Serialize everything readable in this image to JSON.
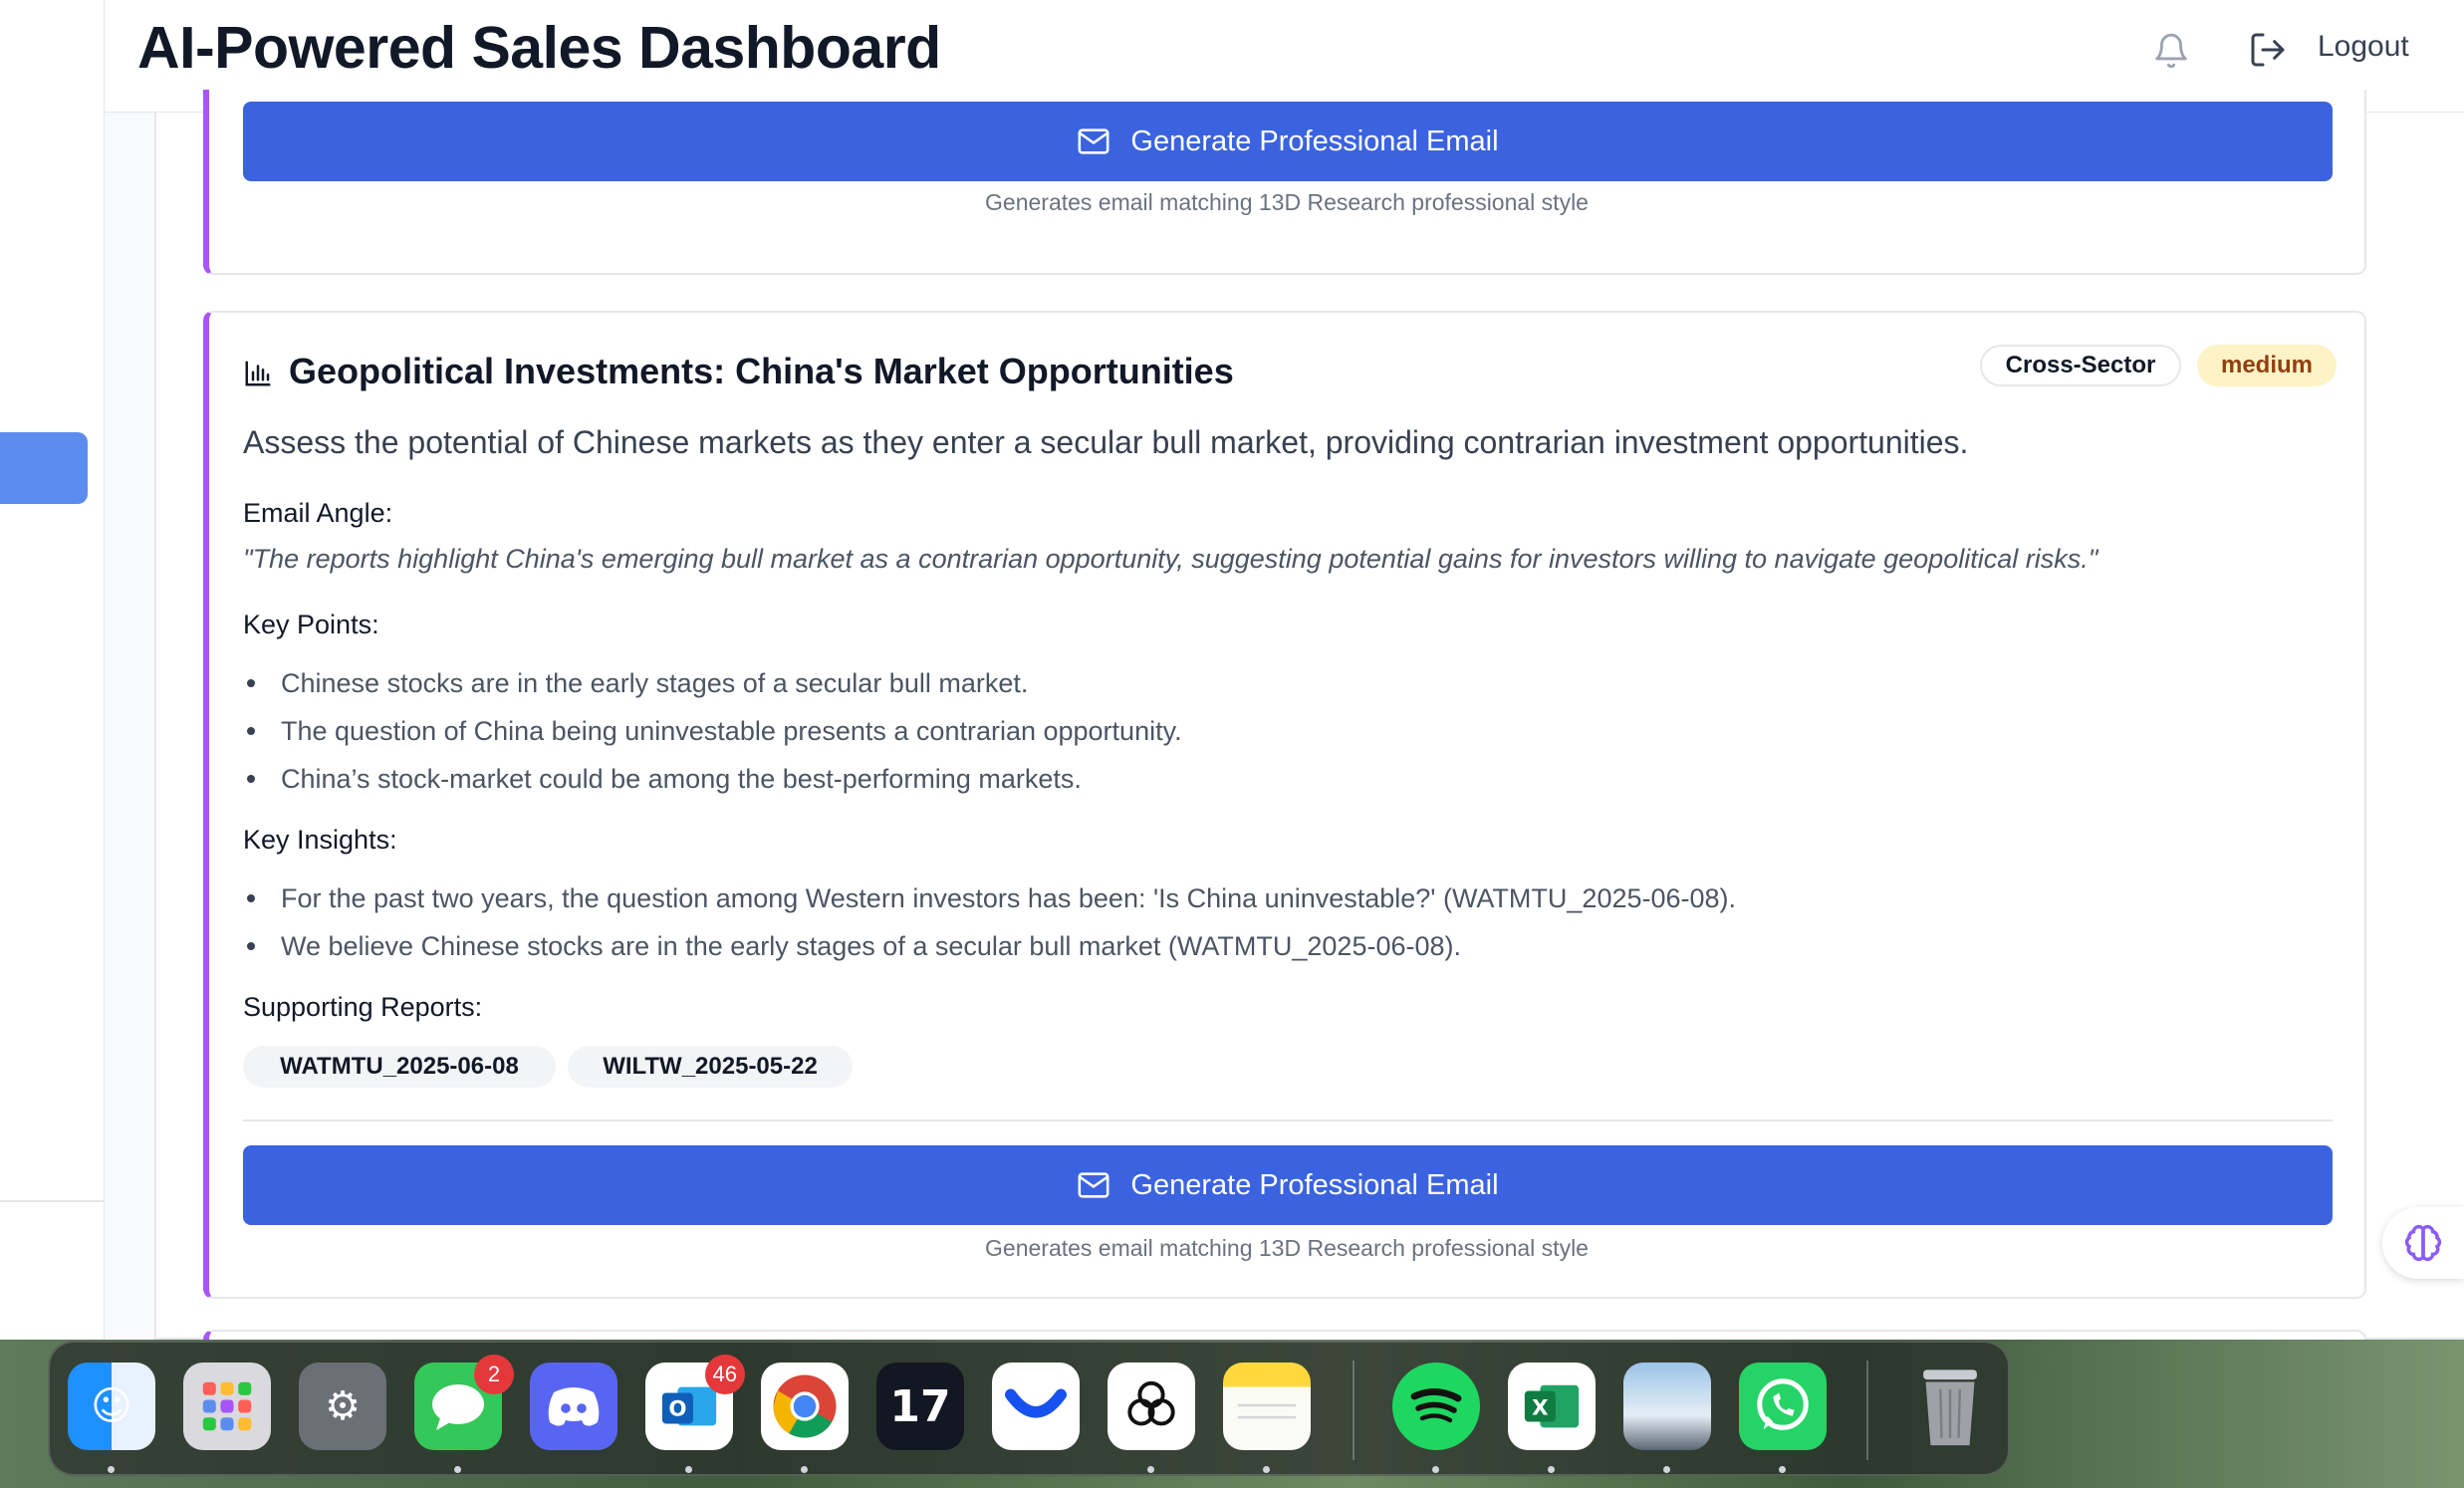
{
  "header": {
    "title": "AI-Powered Sales Dashboard",
    "logout_label": "Logout"
  },
  "top_card": {
    "button_label": "Generate Professional Email",
    "hint": "Generates email matching 13D Research professional style"
  },
  "opportunity": {
    "title": "Geopolitical Investments: China's Market Opportunities",
    "sector_tag": "Cross-Sector",
    "priority_tag": "medium",
    "summary": "Assess the potential of Chinese markets as they enter a secular bull market, providing contrarian investment opportunities.",
    "email_angle_label": "Email Angle:",
    "email_angle": "\"The reports highlight China's emerging bull market as a contrarian opportunity, suggesting potential gains for investors willing to navigate geopolitical risks.\"",
    "key_points_label": "Key Points:",
    "key_points": [
      "Chinese stocks are in the early stages of a secular bull market.",
      "The question of China being uninvestable presents a contrarian opportunity.",
      "China’s stock-market could be among the best-performing markets."
    ],
    "key_insights_label": "Key Insights:",
    "key_insights": [
      "For the past two years, the question among Western investors has been: 'Is China uninvestable?' (WATMTU_2025-06-08).",
      "We believe Chinese stocks are in the early stages of a secular bull market (WATMTU_2025-06-08)."
    ],
    "supporting_reports_label": "Supporting Reports:",
    "supporting_reports": [
      "WATMTU_2025-06-08",
      "WILTW_2025-05-22"
    ],
    "button_label": "Generate Professional Email",
    "hint": "Generates email matching 13D Research professional style"
  },
  "dock": {
    "messages_badge": "2",
    "outlook_badge": "46",
    "apps": [
      "finder",
      "launchpad",
      "system-settings",
      "messages",
      "discord",
      "outlook",
      "chrome",
      "tradingview",
      "coinbase",
      "chatgpt",
      "notes",
      "spotify",
      "excel",
      "preview",
      "whatsapp",
      "trash"
    ]
  },
  "colors": {
    "primary_button": "#3b63e0",
    "card_accent": "#a855f7",
    "priority_bg": "#fef3c7",
    "sidebar_active": "#5b8def"
  }
}
